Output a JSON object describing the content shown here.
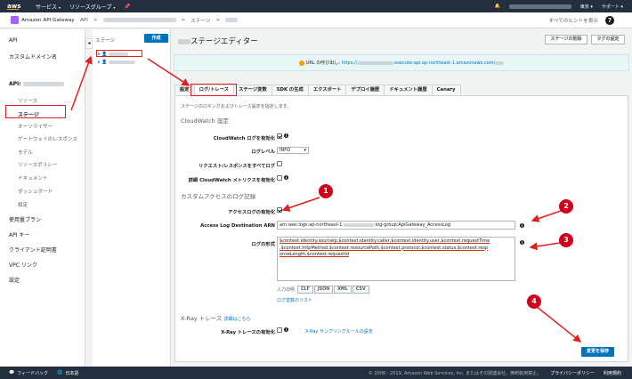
{
  "topbar": {
    "logo": "aws",
    "services": "サービス",
    "resource_groups": "リソースグループ",
    "region": "東京",
    "support": "サポート"
  },
  "breadcrumb": {
    "service": "Amazon API Gateway",
    "api": "API",
    "sep1": ">",
    "stages": "ステージ",
    "sep2": ">",
    "hint": "すべてのヒントを表示"
  },
  "leftnav": {
    "api": "API",
    "custom_domain": "カスタムドメイン名",
    "api_prefix": "API:",
    "items": [
      "リソース",
      "ステージ",
      "オーソライザー",
      "ゲートウェイのレスポンス",
      "モデル",
      "リソースポリシー",
      "ドキュメント",
      "ダッシュボード",
      "設定"
    ],
    "usage_plans": "使用量プラン",
    "api_keys": "API キー",
    "client_certs": "クライアント証明書",
    "vpc_link": "VPC リンク",
    "settings": "設定"
  },
  "stages": {
    "label": "ステージ",
    "create": "作成"
  },
  "editor": {
    "title": "ステージエディター",
    "delete_stage": "ステージの削除",
    "tag_settings": "タグの設定",
    "url_label": "URL の呼び出し:",
    "url_prefix": "https://",
    "url_suffix": ".execute-api.ap-northeast-1.amazonaws.com/"
  },
  "tabs": [
    "設定",
    "ログ/トレース",
    "ステージ変数",
    "SDK の生成",
    "エクスポート",
    "デプロイ履歴",
    "ドキュメント履歴",
    "Canary"
  ],
  "logs": {
    "description": "ステージのロギングおよびトレース設定を指定します。",
    "cloudwatch_heading": "CloudWatch 設定",
    "cw_enable": "CloudWatch ログを有効化",
    "log_level": "ログレベル",
    "log_level_value": "INFO",
    "req_resp": "リクエスト/レスポンスをすべてログ",
    "metrics": "詳細 CloudWatch メトリクスを有効化",
    "custom_heading": "カスタムアクセスのログ記録",
    "access_enable": "アクセスログの有効化",
    "arn_label": "Access Log Destination ARN",
    "arn_prefix": "arn:aws:logs:ap-northeast-1:",
    "arn_suffix": ":log-group:ApiGateway_AccessLog",
    "format_label": "ログの形式",
    "format_lines": [
      "$context.identity.sourceIp,$context.identity.caller,$context.identity.user,$context.requestTime",
      ",$context.httpMethod,$context.resourcePath,$context.protocol,$context.status,$context.resp",
      "onseLength,$context.requestId"
    ],
    "example_label": "入力の例",
    "formats": [
      "CLF",
      "JSON",
      "XML",
      "CSV"
    ],
    "variables_link": "ログ変数のリスト"
  },
  "xray": {
    "heading": "X-Ray トレース",
    "details_link": "詳細はこちら",
    "enable": "X-Ray トレースの有効化",
    "sampling_link": "X-Ray サンプリングルールの設定"
  },
  "save": "変更を保存",
  "markers": [
    "1",
    "2",
    "3",
    "4"
  ],
  "footer": {
    "feedback": "フィードバック",
    "language": "日本語",
    "copyright": "© 2008 - 2019, Amazon Web Services, Inc. またはその関連会社。無断転用禁止。",
    "privacy": "プライバシーポリシー",
    "terms": "利用規約"
  },
  "colors": {
    "topbar": "#232f3e",
    "primary": "#0073bb",
    "annotation": "#d0021b",
    "aws_orange": "#ff9900"
  }
}
